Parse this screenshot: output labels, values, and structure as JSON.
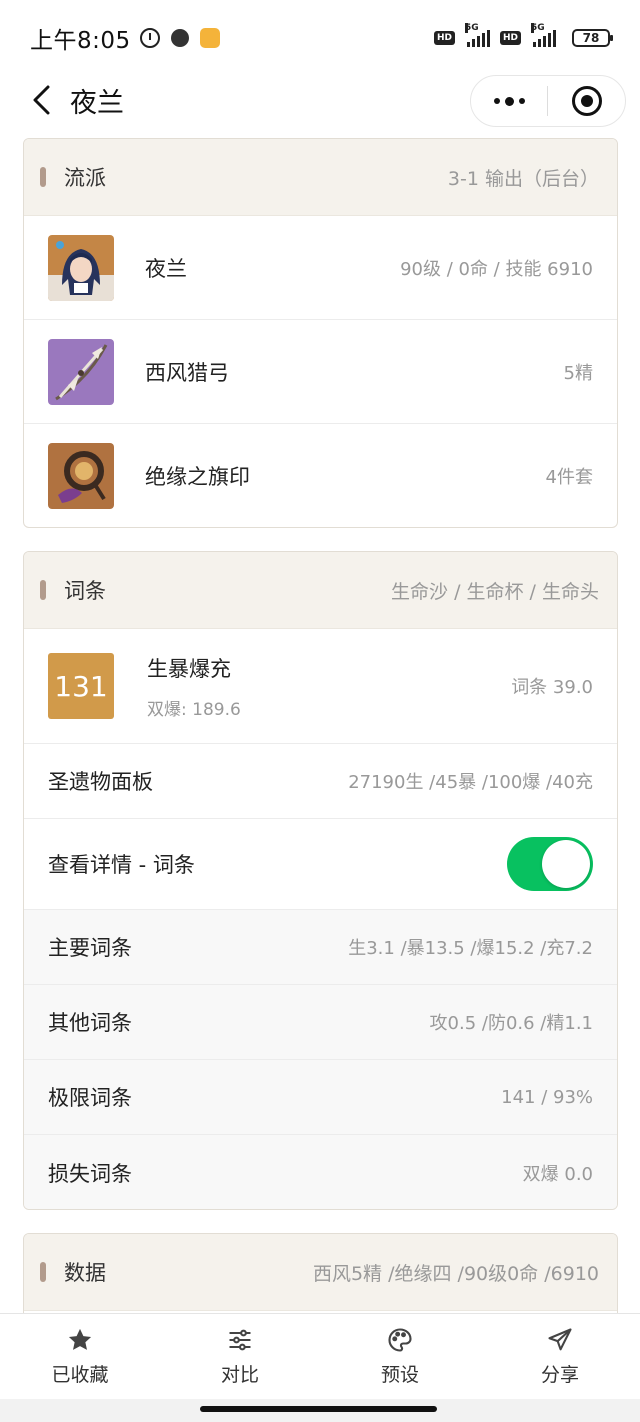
{
  "status_bar": {
    "time": "上午8:05",
    "network_hd": "HD",
    "network_5g": "5G",
    "battery": "78"
  },
  "nav": {
    "title": "夜兰"
  },
  "build_card": {
    "title": "流派",
    "subtitle": "3-1 输出（后台）",
    "items": [
      {
        "name": "夜兰",
        "value": "90级 / 0命 / 技能 6910",
        "thumb_color": "#c98a4b"
      },
      {
        "name": "西风猎弓",
        "value": "5精",
        "thumb_color": "#8f6ab5"
      },
      {
        "name": "绝缘之旗印",
        "value": "4件套",
        "thumb_color": "#b87843"
      }
    ]
  },
  "stats_card": {
    "title": "词条",
    "subtitle": "生命沙 / 生命杯 / 生命头",
    "score": {
      "value": "131",
      "title": "生暴爆充",
      "sub": "双爆: 189.6",
      "right": "词条 39.0",
      "color": "#d19a4a"
    },
    "panel": {
      "label": "圣遗物面板",
      "value": "27190生 /45暴 /100爆 /40充"
    },
    "detail_toggle": {
      "label": "查看详情 - 词条",
      "on": true
    },
    "rows": [
      {
        "label": "主要词条",
        "value": "生3.1 /暴13.5 /爆15.2 /充7.2"
      },
      {
        "label": "其他词条",
        "value": "攻0.5 /防0.6 /精1.1"
      },
      {
        "label": "极限词条",
        "value": "141 / 93%"
      },
      {
        "label": "损失词条",
        "value": "双爆 0.0"
      }
    ]
  },
  "data_card": {
    "title": "数据",
    "subtitle": "西风5精 /绝缘四 /90级0命 /6910"
  },
  "tab_bar": {
    "tabs": [
      {
        "label": "已收藏",
        "icon": "star-icon"
      },
      {
        "label": "对比",
        "icon": "sliders-icon"
      },
      {
        "label": "预设",
        "icon": "palette-icon"
      },
      {
        "label": "分享",
        "icon": "send-icon"
      }
    ]
  },
  "colors": {
    "accent_green": "#08c160",
    "header_bg": "#f5f2ec",
    "header_bar": "#b29b8c"
  }
}
